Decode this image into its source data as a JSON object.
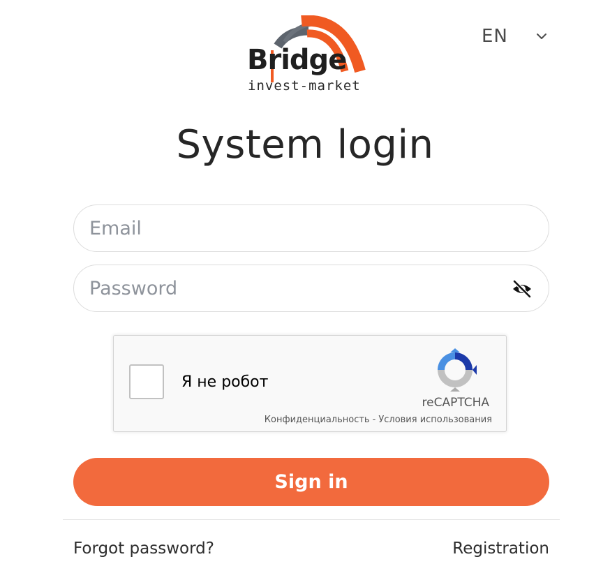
{
  "logo": {
    "brand": "Bridge",
    "tagline": "invest-market",
    "colors": {
      "arc_orange": "#f05a22",
      "arc_gray": "#5d646d"
    }
  },
  "language": {
    "selected": "EN",
    "icon": "chevron-down-icon"
  },
  "title": "System login",
  "form": {
    "email_placeholder": "Email",
    "email_value": "",
    "password_placeholder": "Password",
    "password_value": "",
    "password_toggle_icon": "eye-slash-icon"
  },
  "captcha": {
    "label": "Я не робот",
    "brand": "reCAPTCHA",
    "privacy_link": "Конфиденциальность",
    "separator": "-",
    "terms_link": "Условия использования",
    "checked": false
  },
  "signin_label": "Sign in",
  "footer": {
    "forgot_label": "Forgot password?",
    "register_label": "Registration"
  },
  "colors": {
    "accent": "#f26a3d",
    "text": "#2d2d2d",
    "placeholder": "#8e939b",
    "field_border": "#dcdcdc"
  }
}
